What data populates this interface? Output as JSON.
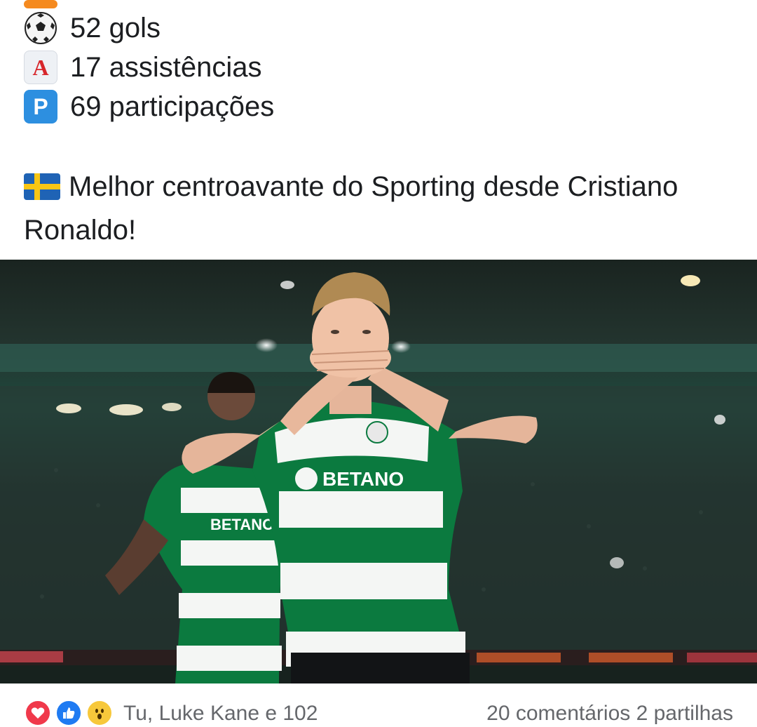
{
  "post": {
    "stats": [
      {
        "icon": "orange-square-icon",
        "text": ""
      },
      {
        "icon": "soccer-ball-icon",
        "text": "52 gols"
      },
      {
        "icon": "letter-a-icon",
        "text": "17 assistências"
      },
      {
        "icon": "letter-p-icon",
        "text": "69 participações"
      }
    ],
    "badge_a": "A",
    "badge_p": "P",
    "headline_flag": "sweden-flag-icon",
    "headline": "Melhor centroavante do Sporting desde Cristiano Ronaldo!"
  },
  "photo": {
    "sponsor_main": "BETANO",
    "sponsor_secondary": "BETANO",
    "colors": {
      "kit_green": "#0b7a3f",
      "kit_white": "#f4f6f4",
      "stadium": "#1d2b27"
    }
  },
  "reactions": {
    "icons": [
      "love-reaction-icon",
      "like-reaction-icon",
      "wow-reaction-icon"
    ],
    "names": "Tu, Luke Kane e 102",
    "counts": "20 comentários  2 partilhas",
    "colors": {
      "love": "#f0394b",
      "like": "#1f7bf2",
      "wow": "#f7c83b"
    }
  }
}
